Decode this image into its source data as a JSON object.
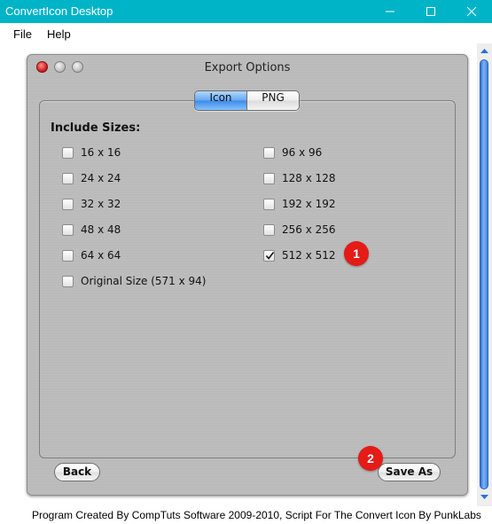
{
  "window": {
    "title": "ConvertIcon Desktop"
  },
  "menu": {
    "file": "File",
    "help": "Help"
  },
  "dialog": {
    "title": "Export Options",
    "tabs": [
      {
        "label": "Icon",
        "selected": true
      },
      {
        "label": "PNG",
        "selected": false
      }
    ],
    "include_label": "Include Sizes:",
    "sizes_left": [
      {
        "label": "16 x 16",
        "checked": false
      },
      {
        "label": "24 x 24",
        "checked": false
      },
      {
        "label": "32 x 32",
        "checked": false
      },
      {
        "label": "48 x 48",
        "checked": false
      },
      {
        "label": "64 x 64",
        "checked": false
      }
    ],
    "sizes_right": [
      {
        "label": "96 x 96",
        "checked": false
      },
      {
        "label": "128 x 128",
        "checked": false
      },
      {
        "label": "192 x 192",
        "checked": false
      },
      {
        "label": "256 x 256",
        "checked": false
      },
      {
        "label": "512 x 512",
        "checked": true
      }
    ],
    "original_size": {
      "label": "Original Size (571 x 94)",
      "checked": false
    },
    "back_label": "Back",
    "save_label": "Save As"
  },
  "badges": {
    "one": "1",
    "two": "2"
  },
  "footer": {
    "text": "Program Created By CompTuts Software 2009-2010, Script For The Convert Icon By PunkLabs"
  },
  "colors": {
    "titlebar": "#00b4c8",
    "badge": "#e41b17",
    "selected_tab": "#5fa5f0"
  }
}
